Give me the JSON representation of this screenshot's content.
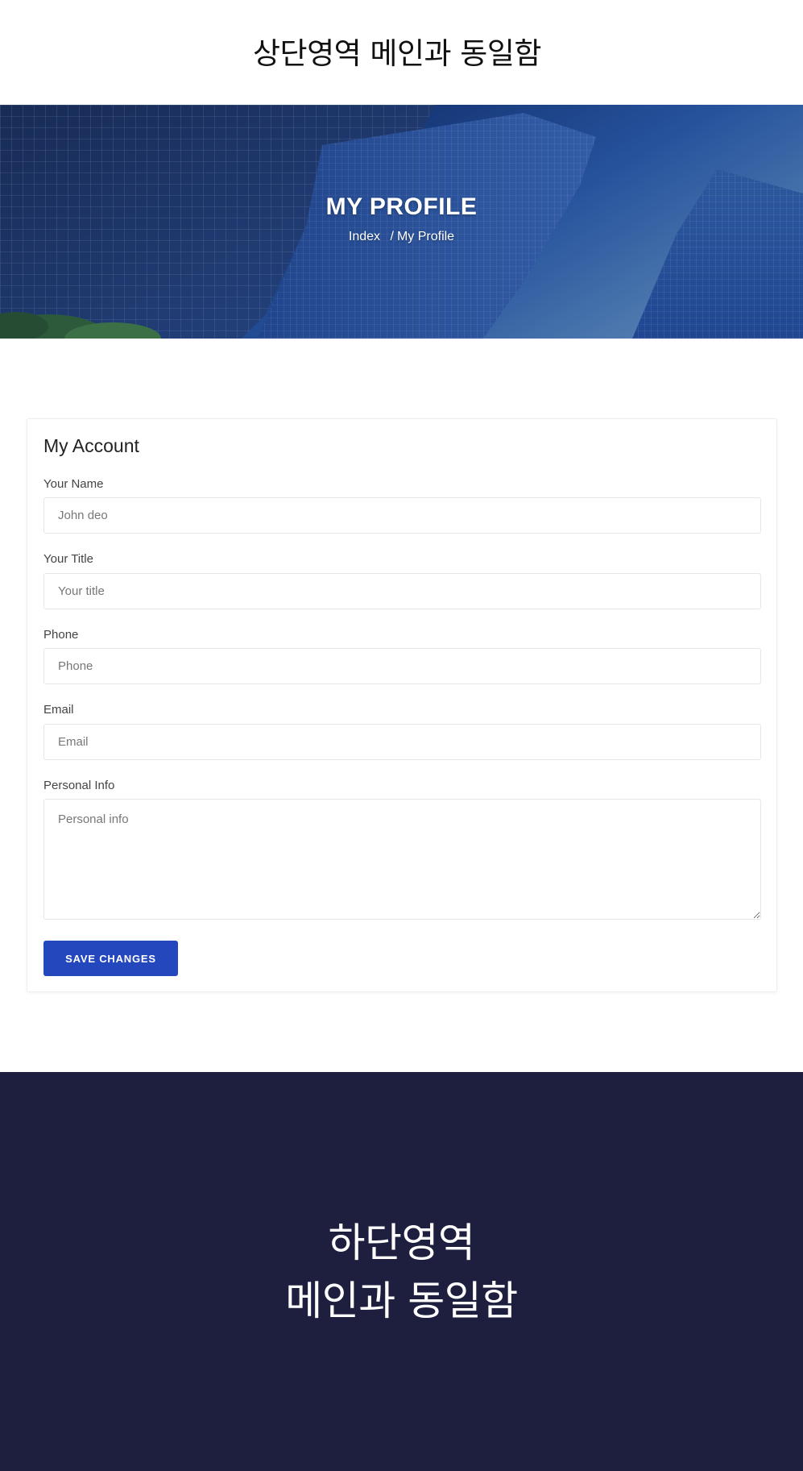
{
  "header": {
    "placeholder_text": "상단영역 메인과 동일함"
  },
  "hero": {
    "title": "MY PROFILE",
    "breadcrumb": {
      "home": "Index",
      "separator": "/",
      "current": "My Profile"
    }
  },
  "account": {
    "title": "My Account",
    "fields": {
      "name": {
        "label": "Your Name",
        "placeholder": "John deo"
      },
      "title": {
        "label": "Your Title",
        "placeholder": "Your title"
      },
      "phone": {
        "label": "Phone",
        "placeholder": "Phone"
      },
      "email": {
        "label": "Email",
        "placeholder": "Email"
      },
      "info": {
        "label": "Personal Info",
        "placeholder": "Personal info"
      }
    },
    "save_label": "SAVE CHANGES"
  },
  "footer": {
    "line1": "하단영역",
    "line2": "메인과 동일함"
  },
  "colors": {
    "primary_button": "#2447bd",
    "footer_bg": "#1e1f3f"
  }
}
